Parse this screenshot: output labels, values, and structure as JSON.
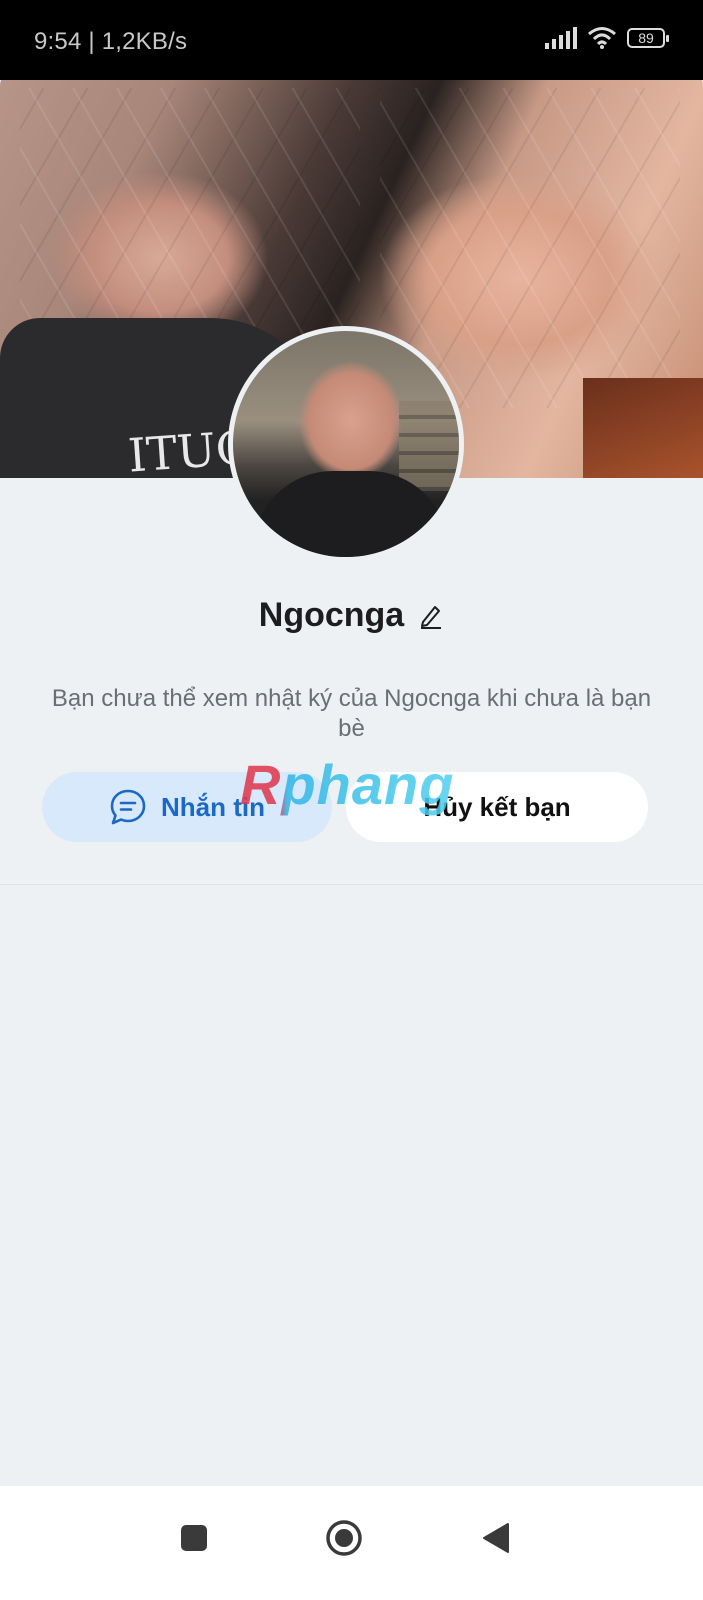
{
  "status_bar": {
    "time": "9:54",
    "speed": "1,2KB/s",
    "battery": "89",
    "icons": [
      "signal-icon",
      "wifi-icon",
      "battery-icon"
    ]
  },
  "profile": {
    "name": "Ngocnga",
    "cover_shirt_text": "ITUCU",
    "notice": "Bạn chưa thể xem nhật ký của Ngocnga khi chưa là bạn bè"
  },
  "actions": {
    "message_label": "Nhắn tin",
    "unfriend_label": "Hủy kết bạn"
  },
  "watermark": "Rphang",
  "nav": {
    "icons": [
      "recent-apps-icon",
      "home-icon",
      "back-icon"
    ]
  },
  "colors": {
    "accent": "#1b68c7",
    "message_button_bg": "#d8e9fb",
    "page_bg": "#eef1f3"
  }
}
